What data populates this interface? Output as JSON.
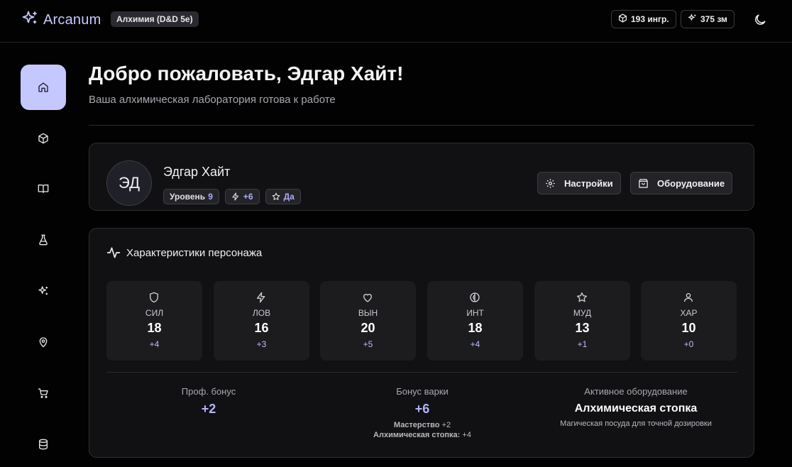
{
  "app": {
    "name": "Arcanum",
    "mode_chip": "Алхимия (D&D 5e)"
  },
  "header": {
    "ingredients": "193 ингр.",
    "gold": "375 зм",
    "theme_icon": "moon-icon"
  },
  "colors": {
    "accent": "#c5c7ff",
    "background": "#020202",
    "card": "#111113"
  },
  "sidebar": {
    "items": [
      {
        "icon": "home-icon",
        "active": true
      },
      {
        "icon": "package-icon"
      },
      {
        "icon": "book-icon"
      },
      {
        "icon": "flask-icon"
      },
      {
        "icon": "sparkles-icon"
      },
      {
        "icon": "map-pin-icon"
      },
      {
        "icon": "cart-icon"
      },
      {
        "icon": "database-icon"
      }
    ]
  },
  "page": {
    "title": "Добро пожаловать, Эдгар Хайт!",
    "subtitle": "Ваша алхимическая лаборатория готова к работе"
  },
  "profile": {
    "initials": "ЭД",
    "name": "Эдгар Хайт",
    "level_label": "Уровень",
    "level_value": "9",
    "bonus_value": "+6",
    "star_value": "Да",
    "settings_label": "Настройки",
    "equipment_label": "Оборудование"
  },
  "stats": {
    "title": "Характеристики персонажа",
    "items": [
      {
        "label": "СИЛ",
        "value": "18",
        "mod": "+4",
        "icon": "shield-icon"
      },
      {
        "label": "ЛОВ",
        "value": "16",
        "mod": "+3",
        "icon": "zap-icon"
      },
      {
        "label": "ВЫН",
        "value": "20",
        "mod": "+5",
        "icon": "heart-icon"
      },
      {
        "label": "ИНТ",
        "value": "18",
        "mod": "+4",
        "icon": "brain-icon"
      },
      {
        "label": "МУД",
        "value": "13",
        "mod": "+1",
        "icon": "star-icon"
      },
      {
        "label": "ХАР",
        "value": "10",
        "mod": "+0",
        "icon": "user-icon"
      }
    ],
    "prof_label": "Проф. бонус",
    "prof_value": "+2",
    "brew_label": "Бонус варки",
    "brew_value": "+6",
    "brew_mastery": "Мастерство",
    "brew_mastery_value": "+2",
    "brew_kit": "Алхимическая стопка:",
    "brew_kit_value": "+4",
    "equip_label": "Активное оборудование",
    "equip_name": "Алхимическая стопка",
    "equip_desc": "Магическая посуда для точной дозировки"
  }
}
